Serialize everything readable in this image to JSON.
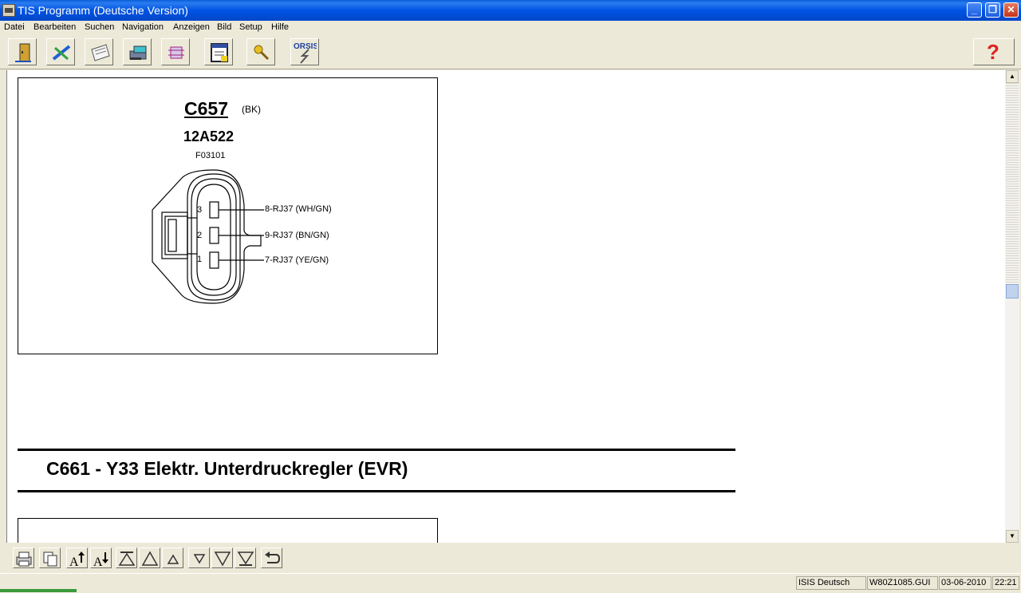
{
  "window": {
    "title": "TIS Programm (Deutsche Version)"
  },
  "menu": [
    "Datei",
    "Bearbeiten",
    "Suchen",
    "Navigation",
    "Anzeigen",
    "Bild",
    "Setup",
    "Hilfe"
  ],
  "toolbar": {
    "orsis_label": "ORSIS",
    "help_label": "?"
  },
  "diagram": {
    "connector": "C657",
    "connector_color": "(BK)",
    "part_number": "12A522",
    "figure_code": "F03101",
    "pins": [
      {
        "num": "3",
        "label": "8-RJ37 (WH/GN)"
      },
      {
        "num": "2",
        "label": "9-RJ37 (BN/GN)"
      },
      {
        "num": "1",
        "label": "7-RJ37 (YE/GN)"
      }
    ]
  },
  "section": {
    "title": "C661 - Y33 Elektr. Unterdruckregler (EVR)"
  },
  "status": {
    "language": "ISIS Deutsch",
    "file": "W80Z1085.GUI",
    "date": "03-06-2010",
    "time": "22:21"
  }
}
